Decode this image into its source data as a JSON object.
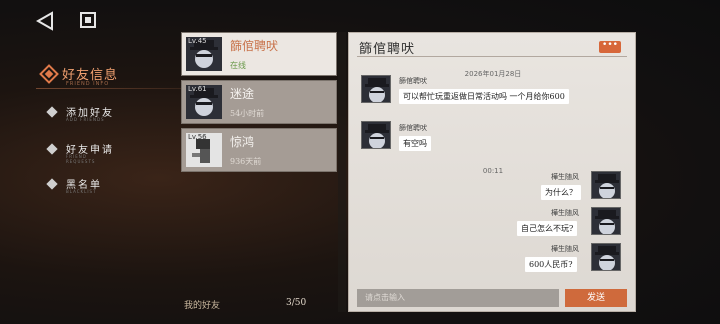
{
  "topbar": {
    "back_icon": "back-triangle-icon",
    "home_icon": "square-home-icon"
  },
  "nav": {
    "title": "好友信息",
    "title_sub": "FRIEND INFO",
    "items": [
      {
        "label": "添加好友",
        "sub": "ADD FRIENDS"
      },
      {
        "label": "好友申请",
        "sub": "FRIEND REQUESTS"
      },
      {
        "label": "黑名单",
        "sub": "BLACKLIST"
      }
    ]
  },
  "friends": [
    {
      "level": "Lv.45",
      "name": "篩倌聘吠",
      "status": "在线"
    },
    {
      "level": "Lv.61",
      "name": "迷途",
      "status": "54小时前"
    },
    {
      "level": "Lv.56",
      "name": "惊鸿",
      "status": "936天前"
    }
  ],
  "friends_footer": {
    "label": "我的好友",
    "count": "3/50"
  },
  "chat": {
    "title": "篩倌聘吠",
    "more_label": "•••",
    "date": "2026年01月28日",
    "time": "00:11",
    "messages_left": [
      {
        "sender": "篩倌聘吠",
        "text": "可以帮忙玩重返做日常活动吗 一个月给你600"
      },
      {
        "sender": "篩倌聘吠",
        "text": "有空吗"
      }
    ],
    "messages_right": [
      {
        "sender": "樺生随风",
        "text": "为什么？"
      },
      {
        "sender": "樺生随风",
        "text": "自己怎么不玩?"
      },
      {
        "sender": "樺生随风",
        "text": "600人民币?"
      }
    ],
    "input_placeholder": "请点击输入",
    "send_label": "发送"
  },
  "colors": {
    "accent": "#d7673a",
    "online": "#6a9a4a",
    "active_name": "#c8724a"
  }
}
